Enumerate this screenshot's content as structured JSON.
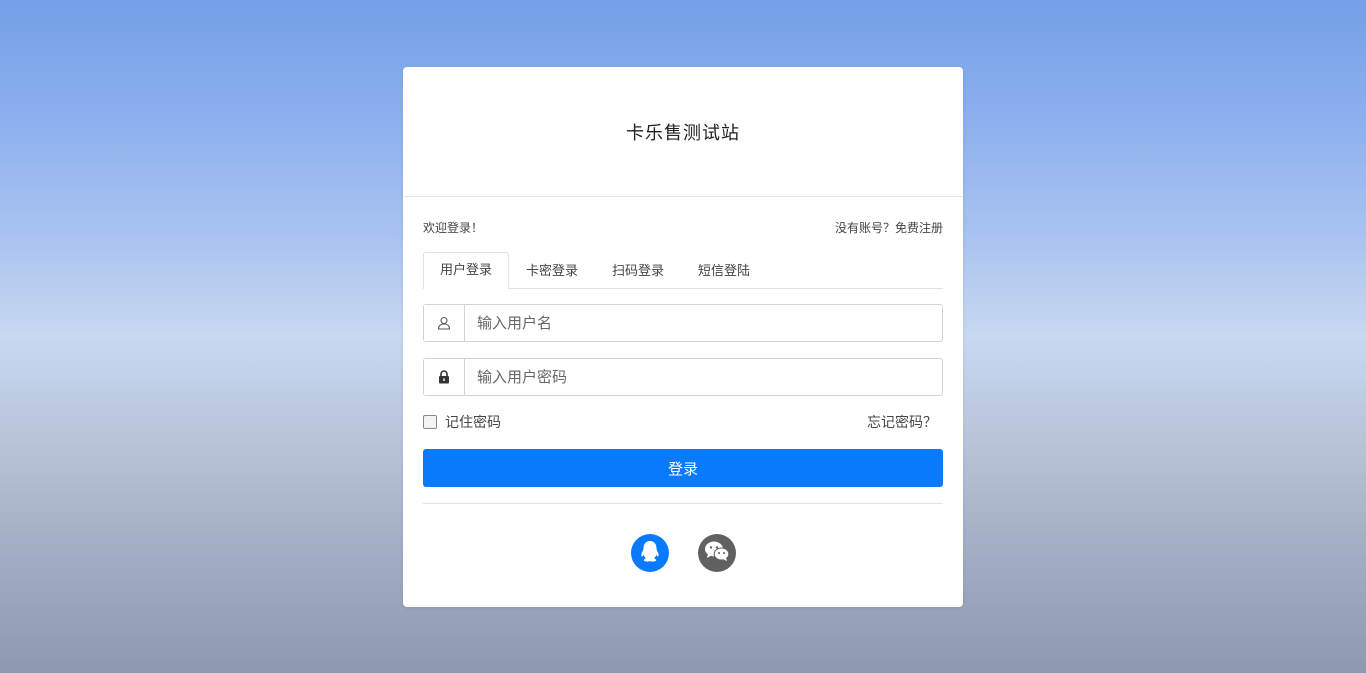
{
  "site": {
    "title": "卡乐售测试站"
  },
  "header": {
    "welcome": "欢迎登录！",
    "register_link": "没有账号？免费注册"
  },
  "tabs": [
    {
      "label": "用户登录",
      "active": true
    },
    {
      "label": "卡密登录",
      "active": false
    },
    {
      "label": "扫码登录",
      "active": false
    },
    {
      "label": "短信登陆",
      "active": false
    }
  ],
  "form": {
    "username": {
      "placeholder": "输入用户名",
      "value": "",
      "icon": "user-icon"
    },
    "password": {
      "placeholder": "输入用户密码",
      "value": "",
      "icon": "lock-icon"
    },
    "remember_label": "记住密码",
    "remember_checked": false,
    "forgot_label": "忘记密码？",
    "login_label": "登录"
  },
  "social": [
    {
      "name": "qq-icon",
      "color": "#0a7afc"
    },
    {
      "name": "wechat-icon",
      "color": "#616161"
    }
  ],
  "colors": {
    "primary": "#0a7afc",
    "wechat_gray": "#616161"
  }
}
